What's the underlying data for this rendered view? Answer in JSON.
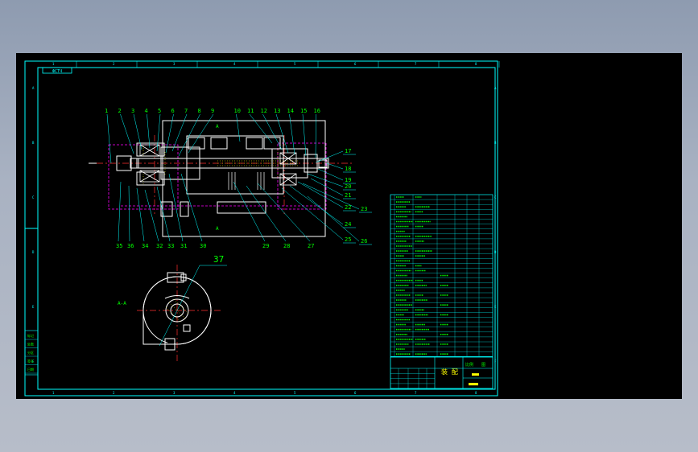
{
  "colors": {
    "background": "#000000",
    "frame": "#00ffff",
    "outline": "#ffffff",
    "labels": "#00ff00",
    "leaders": "#00ffff",
    "center_lines": "#ff3030",
    "hidden_lines": "#ff00ff",
    "hatch": "#ffff00",
    "table_text": "#00ff00",
    "title_accent": "#ffff00"
  },
  "sheet": {
    "stamp": "ФСТЧ",
    "zone_numbers_top": [
      "1",
      "2",
      "3",
      "4",
      "5",
      "6",
      "7",
      "8"
    ],
    "zone_numbers_bottom": [
      "1",
      "2",
      "3",
      "4",
      "5",
      "6",
      "7",
      "8"
    ],
    "zone_letters_left": [
      "A",
      "B",
      "C",
      "D",
      "E",
      "F"
    ],
    "zone_letters_right": [
      "A",
      "B",
      "C",
      "D",
      "E",
      "F"
    ]
  },
  "callouts": {
    "top": [
      "1",
      "2",
      "3",
      "4",
      "5",
      "6",
      "7",
      "8",
      "9",
      "10",
      "11",
      "12",
      "13",
      "14",
      "15",
      "16"
    ],
    "right": [
      "17",
      "18",
      "19",
      "20",
      "21",
      "22",
      "23",
      "24",
      "25",
      "26"
    ],
    "bottom": [
      "35",
      "36",
      "34",
      "32",
      "33",
      "31",
      "30",
      "29",
      "28",
      "27"
    ],
    "section": "37",
    "section_marker": "A-A",
    "view_marker": "A"
  },
  "title_block": {
    "title": "装 配",
    "scale_label": "比例",
    "sheet_label": "图",
    "company": "■■■",
    "drawing_no": "■■■■"
  },
  "side_labels": [
    "标记",
    "处数",
    "分区",
    "签名",
    "日期"
  ]
}
